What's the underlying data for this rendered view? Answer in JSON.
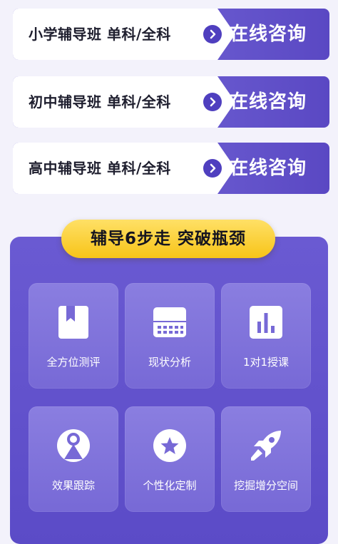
{
  "banners": [
    {
      "label": "小学辅导班  单科/全科",
      "cta": "在线咨询"
    },
    {
      "label": "初中辅导班  单科/全科",
      "cta": "在线咨询"
    },
    {
      "label": "高中辅导班  单科/全科",
      "cta": "在线咨询"
    }
  ],
  "steps_title": "辅导6步走  突破瓶颈",
  "tiles": [
    {
      "label": "全方位测评",
      "icon": "book-icon"
    },
    {
      "label": "现状分析",
      "icon": "keyboard-icon"
    },
    {
      "label": "1对1授课",
      "icon": "bar-chart-icon"
    },
    {
      "label": "效果跟踪",
      "icon": "tracking-icon"
    },
    {
      "label": "个性化定制",
      "icon": "star-icon"
    },
    {
      "label": "挖掘增分空间",
      "icon": "rocket-icon"
    }
  ],
  "colors": {
    "accent": "#5a48c3",
    "panel": "#6152cc",
    "pill": "#f7c418",
    "background": "#f3f2fb"
  }
}
